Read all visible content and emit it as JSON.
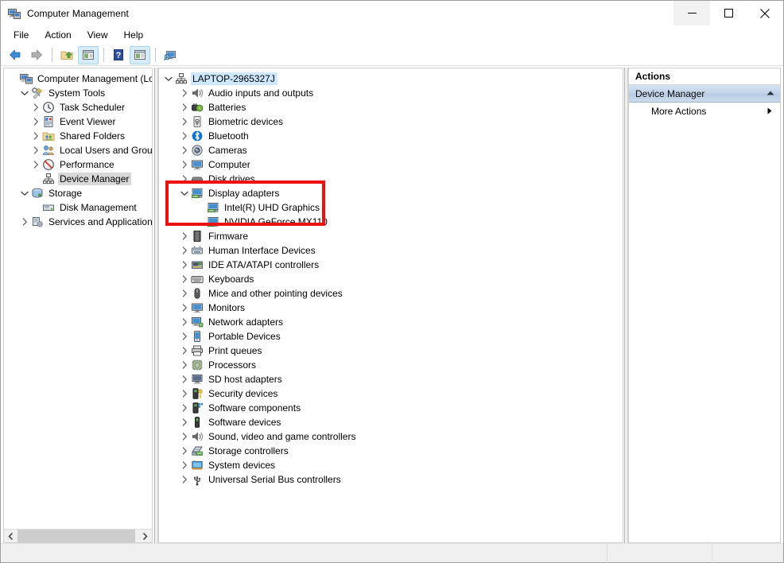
{
  "window": {
    "title": "Computer Management",
    "title_icon": "computer-management-icon",
    "caption": {
      "minimize": "–",
      "maximize": "☐",
      "close": "✕",
      "minimize_hover": true
    }
  },
  "menubar": {
    "items": [
      {
        "label": "File"
      },
      {
        "label": "Action"
      },
      {
        "label": "View"
      },
      {
        "label": "Help"
      }
    ]
  },
  "toolbar": {
    "buttons": [
      {
        "name": "back-button",
        "icon": "back-arrow-icon",
        "active": false
      },
      {
        "name": "forward-button",
        "icon": "forward-arrow-icon",
        "active": false
      },
      {
        "name": "up-one-level-button",
        "icon": "folder-up-icon",
        "active": false
      },
      {
        "name": "show-hide-console-tree-button",
        "icon": "console-tree-icon",
        "active": true
      },
      {
        "name": "help-button",
        "icon": "question-mark-icon",
        "active": false
      },
      {
        "name": "show-hide-action-pane-button",
        "icon": "action-pane-icon",
        "active": true
      },
      {
        "name": "properties-button",
        "icon": "monitor-search-icon",
        "active": false
      }
    ]
  },
  "console_tree": {
    "items": [
      {
        "label": "Computer Management (Local",
        "indent": 0,
        "twisty": "none",
        "icon": "computer-management-icon",
        "selected": "none"
      },
      {
        "label": "System Tools",
        "indent": 1,
        "twisty": "expanded",
        "icon": "system-tools-icon",
        "selected": "none"
      },
      {
        "label": "Task Scheduler",
        "indent": 2,
        "twisty": "collapsed",
        "icon": "clock-icon",
        "selected": "none"
      },
      {
        "label": "Event Viewer",
        "indent": 2,
        "twisty": "collapsed",
        "icon": "event-viewer-icon",
        "selected": "none"
      },
      {
        "label": "Shared Folders",
        "indent": 2,
        "twisty": "collapsed",
        "icon": "shared-folders-icon",
        "selected": "none"
      },
      {
        "label": "Local Users and Groups",
        "indent": 2,
        "twisty": "collapsed",
        "icon": "users-group-icon",
        "selected": "none"
      },
      {
        "label": "Performance",
        "indent": 2,
        "twisty": "collapsed",
        "icon": "performance-icon",
        "selected": "none"
      },
      {
        "label": "Device Manager",
        "indent": 2,
        "twisty": "none",
        "icon": "device-manager-icon",
        "selected": "grey"
      },
      {
        "label": "Storage",
        "indent": 1,
        "twisty": "expanded",
        "icon": "storage-icon",
        "selected": "none"
      },
      {
        "label": "Disk Management",
        "indent": 2,
        "twisty": "none",
        "icon": "disk-management-icon",
        "selected": "none"
      },
      {
        "label": "Services and Applications",
        "indent": 1,
        "twisty": "collapsed",
        "icon": "services-icon",
        "selected": "none"
      }
    ]
  },
  "device_tree": {
    "items": [
      {
        "label": "LAPTOP-2965327J",
        "indent": 0,
        "twisty": "expanded",
        "icon": "computer-node-icon",
        "selected": "blue"
      },
      {
        "label": "Audio inputs and outputs",
        "indent": 1,
        "twisty": "collapsed",
        "icon": "speaker-icon",
        "selected": "none"
      },
      {
        "label": "Batteries",
        "indent": 1,
        "twisty": "collapsed",
        "icon": "battery-icon",
        "selected": "none"
      },
      {
        "label": "Biometric devices",
        "indent": 1,
        "twisty": "collapsed",
        "icon": "fingerprint-icon",
        "selected": "none"
      },
      {
        "label": "Bluetooth",
        "indent": 1,
        "twisty": "collapsed",
        "icon": "bluetooth-icon",
        "selected": "none"
      },
      {
        "label": "Cameras",
        "indent": 1,
        "twisty": "collapsed",
        "icon": "camera-icon",
        "selected": "none"
      },
      {
        "label": "Computer",
        "indent": 1,
        "twisty": "collapsed",
        "icon": "monitor-icon",
        "selected": "none"
      },
      {
        "label": "Disk drives",
        "indent": 1,
        "twisty": "collapsed",
        "icon": "disk-drive-icon",
        "selected": "none"
      },
      {
        "label": "Display adapters",
        "indent": 1,
        "twisty": "expanded",
        "icon": "display-adapter-icon",
        "selected": "none"
      },
      {
        "label": "Intel(R) UHD Graphics",
        "indent": 2,
        "twisty": "none",
        "icon": "display-adapter-icon",
        "selected": "none"
      },
      {
        "label": "NVIDIA GeForce MX110",
        "indent": 2,
        "twisty": "none",
        "icon": "display-adapter-icon",
        "selected": "none"
      },
      {
        "label": "Firmware",
        "indent": 1,
        "twisty": "collapsed",
        "icon": "firmware-chip-icon",
        "selected": "none"
      },
      {
        "label": "Human Interface Devices",
        "indent": 1,
        "twisty": "collapsed",
        "icon": "hid-icon",
        "selected": "none"
      },
      {
        "label": "IDE ATA/ATAPI controllers",
        "indent": 1,
        "twisty": "collapsed",
        "icon": "ide-controller-icon",
        "selected": "none"
      },
      {
        "label": "Keyboards",
        "indent": 1,
        "twisty": "collapsed",
        "icon": "keyboard-icon",
        "selected": "none"
      },
      {
        "label": "Mice and other pointing devices",
        "indent": 1,
        "twisty": "collapsed",
        "icon": "mouse-icon",
        "selected": "none"
      },
      {
        "label": "Monitors",
        "indent": 1,
        "twisty": "collapsed",
        "icon": "monitor-icon",
        "selected": "none"
      },
      {
        "label": "Network adapters",
        "indent": 1,
        "twisty": "collapsed",
        "icon": "network-adapter-icon",
        "selected": "none"
      },
      {
        "label": "Portable Devices",
        "indent": 1,
        "twisty": "collapsed",
        "icon": "portable-device-icon",
        "selected": "none"
      },
      {
        "label": "Print queues",
        "indent": 1,
        "twisty": "collapsed",
        "icon": "printer-icon",
        "selected": "none"
      },
      {
        "label": "Processors",
        "indent": 1,
        "twisty": "collapsed",
        "icon": "processor-icon",
        "selected": "none"
      },
      {
        "label": "SD host adapters",
        "indent": 1,
        "twisty": "collapsed",
        "icon": "sd-host-adapter-icon",
        "selected": "none"
      },
      {
        "label": "Security devices",
        "indent": 1,
        "twisty": "collapsed",
        "icon": "security-device-icon",
        "selected": "none"
      },
      {
        "label": "Software components",
        "indent": 1,
        "twisty": "collapsed",
        "icon": "software-component-icon",
        "selected": "none"
      },
      {
        "label": "Software devices",
        "indent": 1,
        "twisty": "collapsed",
        "icon": "software-device-icon",
        "selected": "none"
      },
      {
        "label": "Sound, video and game controllers",
        "indent": 1,
        "twisty": "collapsed",
        "icon": "speaker-icon",
        "selected": "none"
      },
      {
        "label": "Storage controllers",
        "indent": 1,
        "twisty": "collapsed",
        "icon": "storage-controller-icon",
        "selected": "none"
      },
      {
        "label": "System devices",
        "indent": 1,
        "twisty": "collapsed",
        "icon": "system-device-icon",
        "selected": "none"
      },
      {
        "label": "Universal Serial Bus controllers",
        "indent": 1,
        "twisty": "collapsed",
        "icon": "usb-icon",
        "selected": "none"
      }
    ]
  },
  "actions_pane": {
    "header": "Actions",
    "group_title": "Device Manager",
    "collapse_icon": "triangle-up-icon",
    "items": [
      {
        "label": "More Actions",
        "submenu_icon": "triangle-right-icon"
      }
    ]
  },
  "statusbar": {
    "cells": [
      "",
      "",
      ""
    ]
  },
  "annotation": {
    "color": "#ee1111",
    "target": "Display adapters"
  }
}
